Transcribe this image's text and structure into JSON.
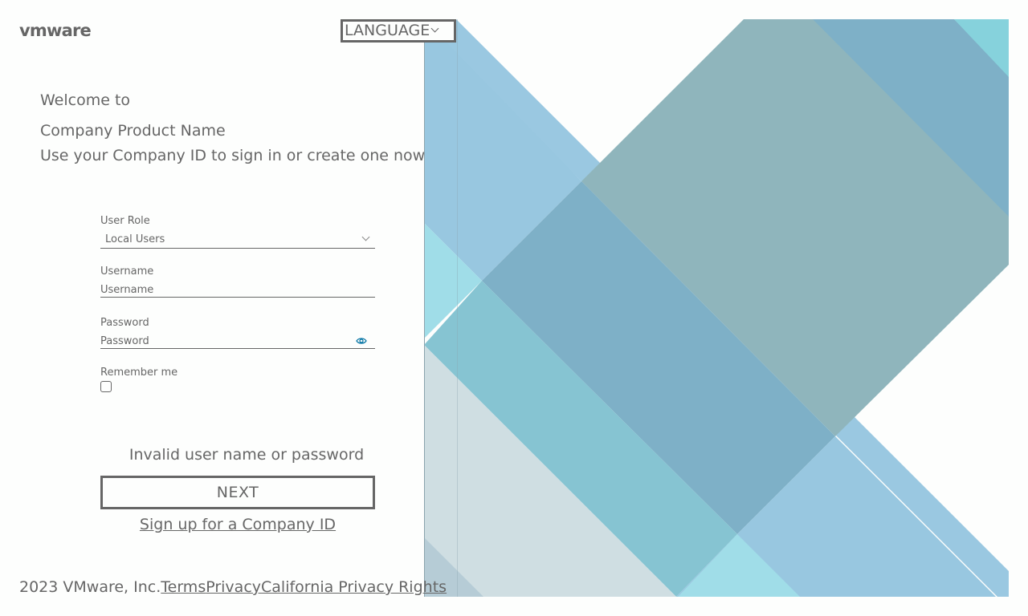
{
  "brand": {
    "logo_text": "vmware"
  },
  "header": {
    "language_label": "LANGUAGE"
  },
  "intro": {
    "welcome": "Welcome to",
    "product": "Company Product Name",
    "subtitle": "Use your Company ID to sign in or create one now"
  },
  "form": {
    "role_label": "User Role",
    "role_value": "Local Users",
    "username_label": "Username",
    "username_placeholder": "Username",
    "password_label": "Password",
    "password_placeholder": "Password",
    "remember_label": "Remember me"
  },
  "error_message": "Invalid user name or password",
  "next_label": "NEXT",
  "signup_label": "Sign up for a Company ID",
  "footer": {
    "copyright": "2023 VMware, Inc.",
    "terms": "Terms",
    "privacy": "Privacy",
    "california": "California Privacy Rights"
  },
  "colors": {
    "text": "#666666",
    "accent": "#0072a3",
    "background": "#fdfefd",
    "art_blue": "#98c7e0",
    "art_teal": "#8fb5bc",
    "art_cyan": "#a0dde8",
    "art_grey": "#cfdee2"
  },
  "icons": {
    "eye": "eye-icon",
    "chevron": "chevron-down-icon"
  }
}
